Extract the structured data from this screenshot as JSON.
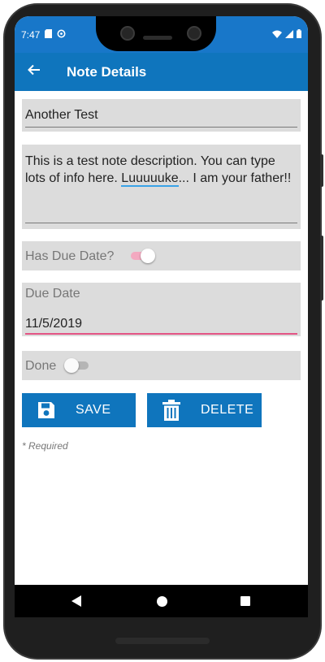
{
  "status_bar": {
    "time": "7:47",
    "icons": [
      "sd-card-icon",
      "sync-icon",
      "wifi-icon",
      "signal-icon",
      "battery-icon"
    ]
  },
  "app_bar": {
    "title": "Note Details",
    "back_icon": "arrow-left-icon"
  },
  "form": {
    "title_value": "Another Test",
    "description_before": "This is a test note description.  You can type lots of info here.  ",
    "description_misspelled": "Luuuuuke",
    "description_after": "... I am your father!!",
    "has_due_date_label": "Has Due Date?",
    "has_due_date_on": true,
    "due_date_label": "Due Date",
    "due_date_value": "11/5/2019",
    "done_label": "Done",
    "done_on": false
  },
  "actions": {
    "save_label": "SAVE",
    "save_icon": "floppy-disk-icon",
    "delete_label": "DELETE",
    "delete_icon": "trash-icon"
  },
  "footnote": "* Required",
  "colors": {
    "primary": "#0f75bd",
    "status_bar": "#1877c9",
    "field_bg": "#dcdcdc",
    "accent": "#e35585"
  }
}
